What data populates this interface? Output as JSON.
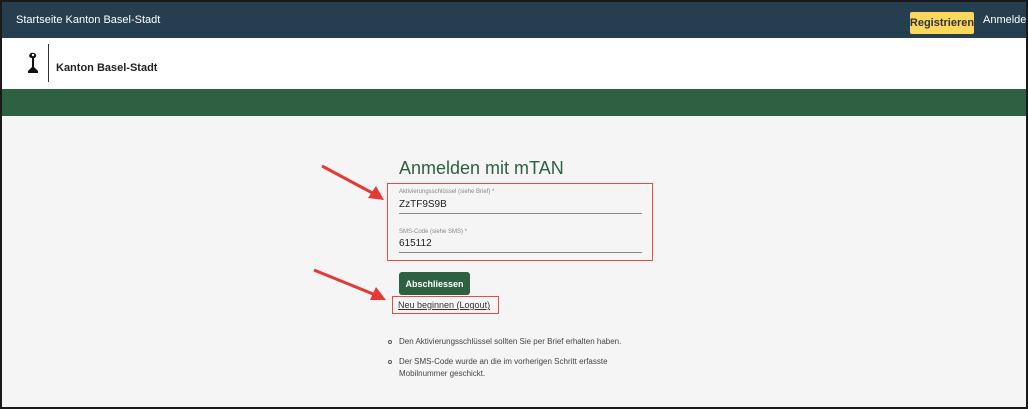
{
  "topbar": {
    "home_link": "Startseite Kanton Basel-Stadt",
    "register_button": "Registrieren",
    "login_link": "Anmelden"
  },
  "logo": {
    "text": "Kanton Basel-Stadt",
    "icon": "baselstab-icon"
  },
  "form": {
    "title": "Anmelden mit mTAN",
    "activation_key": {
      "label": "Aktivierungsschlüssel (siehe Brief) *",
      "value": "ZzTF9S9B"
    },
    "sms_code": {
      "label": "SMS-Code (siehe SMS) *",
      "value": "615112"
    },
    "finish_button": "Abschliessen",
    "restart_link": "Neu beginnen (Logout)"
  },
  "info": {
    "items": [
      "Den Aktivierungsschlüssel sollten Sie per Brief erhalten haben.",
      "Der SMS-Code wurde an die im vorherigen Schritt erfasste",
      "Mobilnummer geschickt."
    ]
  },
  "colors": {
    "topbar": "#263f50",
    "accent_green": "#2e6042",
    "register_yellow": "#fbd75b",
    "annotation_red": "#e74c4c"
  }
}
